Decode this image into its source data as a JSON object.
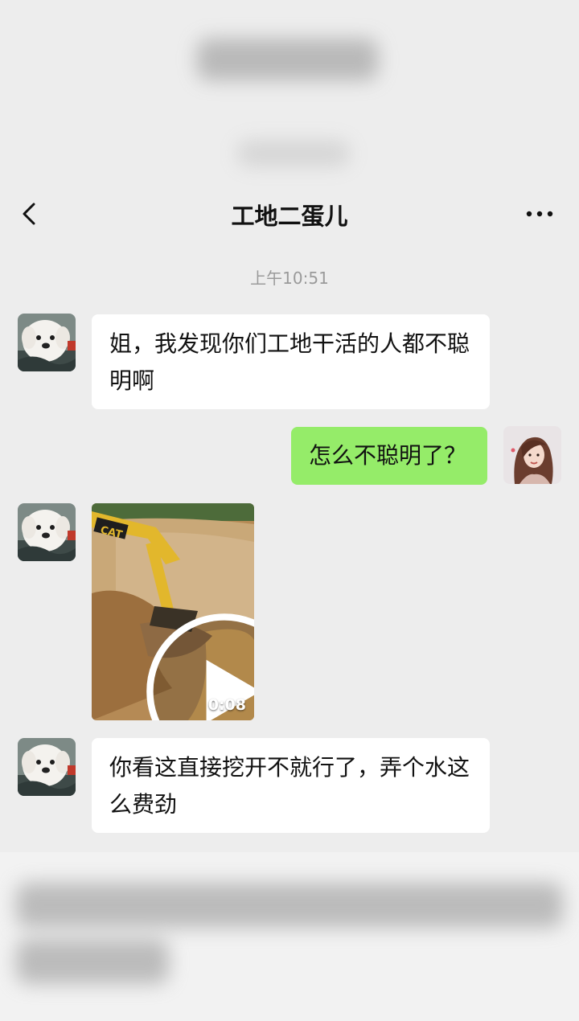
{
  "colors": {
    "background": "#ededed",
    "incoming_bubble": "#ffffff",
    "outgoing_bubble": "#95ec69",
    "timestamp_text": "#9a9a9a"
  },
  "navbar": {
    "title": "工地二蛋儿",
    "back_icon": "chevron-left-icon",
    "more_icon": "more-dots-icon"
  },
  "chat": {
    "timestamp": "上午10:51",
    "messages": [
      {
        "side": "incoming",
        "type": "text",
        "text": "姐，我发现你们工地干活的人都不聪明啊"
      },
      {
        "side": "outgoing",
        "type": "text",
        "text": "怎么不聪明了？"
      },
      {
        "side": "incoming",
        "type": "video",
        "duration": "0:08",
        "icon": "play-icon"
      },
      {
        "side": "incoming",
        "type": "text",
        "text": "你看这直接挖开不就行了，弄个水这么费劲"
      }
    ]
  }
}
